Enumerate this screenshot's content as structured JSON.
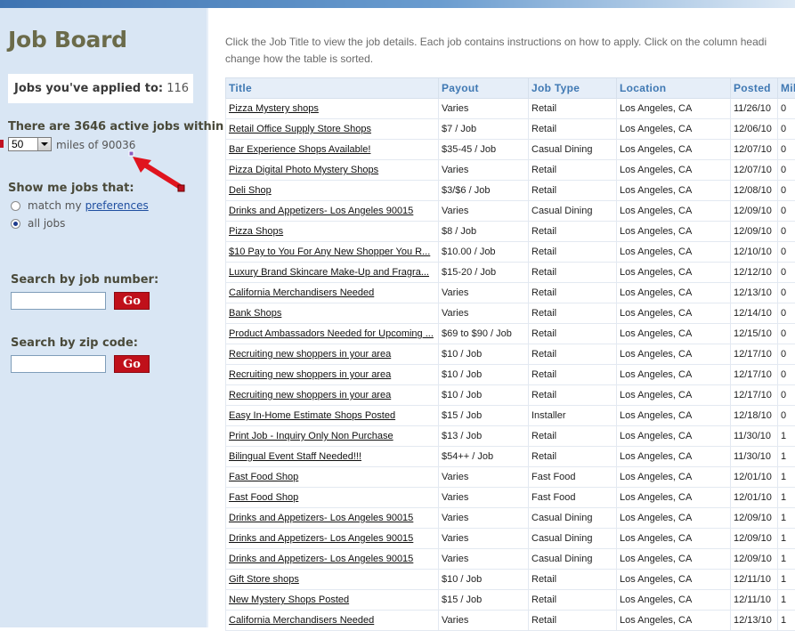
{
  "sidebar": {
    "title": "Job Board",
    "applied_label": "Jobs you've applied to:",
    "applied_count": "116",
    "active_jobs_text": "There are 3646 active jobs within",
    "miles_value": "50",
    "miles_text": "miles of 90036",
    "show_me_label": "Show me jobs that:",
    "radio_match_label": "match my",
    "radio_match_link": "preferences",
    "radio_all_label": "all jobs",
    "search_job_label": "Search by job number:",
    "search_zip_label": "Search by zip code:",
    "go_label": "Go"
  },
  "intro": {
    "line1": "Click the Job Title to view the job details. Each job contains instructions on how to apply. Click on the column headi",
    "line2": "change how the table is sorted."
  },
  "table": {
    "headers": [
      "Title",
      "Payout",
      "Job Type",
      "Location",
      "Posted",
      "Mil"
    ],
    "rows": [
      [
        "Pizza Mystery shops",
        "Varies",
        "Retail",
        "Los Angeles, CA",
        "11/26/10",
        "0"
      ],
      [
        "Retail Office Supply Store Shops",
        "$7 / Job",
        "Retail",
        "Los Angeles, CA",
        "12/06/10",
        "0"
      ],
      [
        "Bar Experience Shops Available!",
        "$35-45 / Job",
        "Casual Dining",
        "Los Angeles, CA",
        "12/07/10",
        "0"
      ],
      [
        "Pizza Digital Photo Mystery Shops",
        "Varies",
        "Retail",
        "Los Angeles, CA",
        "12/07/10",
        "0"
      ],
      [
        "Deli Shop",
        "$3/$6 / Job",
        "Retail",
        "Los Angeles, CA",
        "12/08/10",
        "0"
      ],
      [
        "Drinks and Appetizers- Los Angeles 90015",
        "Varies",
        "Casual Dining",
        "Los Angeles, CA",
        "12/09/10",
        "0"
      ],
      [
        "Pizza Shops",
        "$8 / Job",
        "Retail",
        "Los Angeles, CA",
        "12/09/10",
        "0"
      ],
      [
        "$10 Pay to You For Any New Shopper You R...",
        "$10.00 / Job",
        "Retail",
        "Los Angeles, CA",
        "12/10/10",
        "0"
      ],
      [
        "Luxury Brand Skincare Make-Up and Fragra...",
        "$15-20 / Job",
        "Retail",
        "Los Angeles, CA",
        "12/12/10",
        "0"
      ],
      [
        "California Merchandisers Needed",
        "Varies",
        "Retail",
        "Los Angeles, CA",
        "12/13/10",
        "0"
      ],
      [
        "Bank Shops",
        "Varies",
        "Retail",
        "Los Angeles, CA",
        "12/14/10",
        "0"
      ],
      [
        "Product Ambassadors Needed for Upcoming ...",
        "$69 to $90 / Job",
        "Retail",
        "Los Angeles, CA",
        "12/15/10",
        "0"
      ],
      [
        "Recruiting new shoppers in your area",
        "$10 / Job",
        "Retail",
        "Los Angeles, CA",
        "12/17/10",
        "0"
      ],
      [
        "Recruiting new shoppers in your area",
        "$10 / Job",
        "Retail",
        "Los Angeles, CA",
        "12/17/10",
        "0"
      ],
      [
        "Recruiting new shoppers in your area",
        "$10 / Job",
        "Retail",
        "Los Angeles, CA",
        "12/17/10",
        "0"
      ],
      [
        "Easy In-Home Estimate Shops Posted",
        "$15 / Job",
        "Installer",
        "Los Angeles, CA",
        "12/18/10",
        "0"
      ],
      [
        "Print Job - Inquiry Only Non Purchase",
        "$13 / Job",
        "Retail",
        "Los Angeles, CA",
        "11/30/10",
        "1"
      ],
      [
        "Bilingual Event Staff Needed!!!",
        "$54++ / Job",
        "Retail",
        "Los Angeles, CA",
        "11/30/10",
        "1"
      ],
      [
        "Fast Food Shop",
        "Varies",
        "Fast Food",
        "Los Angeles, CA",
        "12/01/10",
        "1"
      ],
      [
        "Fast Food Shop",
        "Varies",
        "Fast Food",
        "Los Angeles, CA",
        "12/01/10",
        "1"
      ],
      [
        "Drinks and Appetizers- Los Angeles 90015",
        "Varies",
        "Casual Dining",
        "Los Angeles, CA",
        "12/09/10",
        "1"
      ],
      [
        "Drinks and Appetizers- Los Angeles 90015",
        "Varies",
        "Casual Dining",
        "Los Angeles, CA",
        "12/09/10",
        "1"
      ],
      [
        "Drinks and Appetizers- Los Angeles 90015",
        "Varies",
        "Casual Dining",
        "Los Angeles, CA",
        "12/09/10",
        "1"
      ],
      [
        "Gift Store shops",
        "$10 / Job",
        "Retail",
        "Los Angeles, CA",
        "12/11/10",
        "1"
      ],
      [
        "New Mystery Shops Posted",
        "$15 / Job",
        "Retail",
        "Los Angeles, CA",
        "12/11/10",
        "1"
      ],
      [
        "California Merchandisers Needed",
        "Varies",
        "Retail",
        "Los Angeles, CA",
        "12/13/10",
        "1"
      ]
    ]
  },
  "colors": {
    "sidebar_bg": "#d9e6f4",
    "header_text": "#3f78b3",
    "go_button": "#c0101a",
    "arrow": "#e0141e"
  },
  "icons": {
    "arrow": "red-arrow-icon",
    "dropdown": "chevron-down-icon"
  }
}
